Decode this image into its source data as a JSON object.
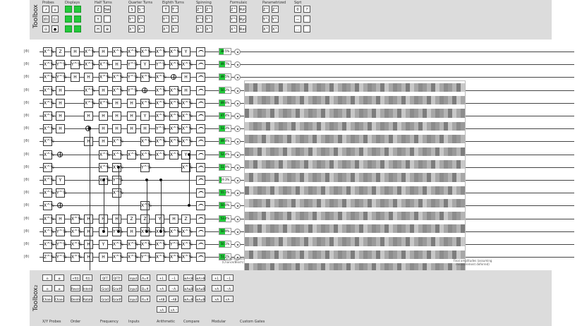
{
  "toolbox_top": {
    "label": "Toolbox",
    "groups": [
      {
        "title": "Probes",
        "gates": [
          "↗",
          "⌂",
          "|0⟩⟨0|",
          "|1⟩⟨1|",
          "⊙",
          "●"
        ]
      },
      {
        "title": "Displays",
        "gates": [
          "",
          "",
          "",
          "",
          "",
          ""
        ],
        "green": true
      },
      {
        "title": "Half Turns",
        "gates": [
          "Z",
          "Swap",
          "Y",
          "",
          "H",
          "⊕"
        ]
      },
      {
        "title": "Quarter Turns",
        "gates": [
          "S",
          "S⁻¹",
          "Y^½",
          "Y^-½",
          "X^½",
          "X^-½"
        ]
      },
      {
        "title": "Eighth Turns",
        "gates": [
          "T",
          "T⁻¹",
          "Y^¼",
          "Y^-¼",
          "X^¼",
          "X^-¼"
        ]
      },
      {
        "title": "Spinning",
        "gates": [
          "Z^t",
          "Z^-t",
          "Y^t",
          "Y^-t",
          "X^t",
          "X^-t"
        ]
      },
      {
        "title": "Formulaic",
        "gates": [
          "Z^f(t)",
          "Rz(f(t))",
          "Y^f(t)",
          "Ry(f(t))",
          "X^f(t)",
          "Rx(f(t))"
        ]
      },
      {
        "title": "Parametrized",
        "gates": [
          "Z^A/2ⁿ",
          "Z^-A/2ⁿ",
          "Y^A/2ⁿ",
          "Y^-A/2ⁿ",
          "X^A/2ⁿ",
          "X^-A/2ⁿ"
        ]
      },
      {
        "title": "Sqrt",
        "gates": [
          "0",
          "?",
          "—",
          "",
          "...",
          ""
        ]
      }
    ]
  },
  "toolbox_bottom": {
    "label": "Toolbox₂",
    "groups": [
      {
        "title": "X/Y Probes",
        "gates": [
          "⊖",
          "⊗",
          "⊖",
          "⊗",
          "Chance",
          "Chance"
        ]
      },
      {
        "title": "Order",
        "gates": [
          "+f(t)",
          "-f(t)",
          "Reverse",
          "Interleave",
          "Deinterleave",
          "Rotate"
        ]
      },
      {
        "title": "Frequency",
        "gates": [
          "QFT",
          "QFT†",
          "Grad",
          "Grad†",
          "Grad",
          "Grad†"
        ]
      },
      {
        "title": "Inputs",
        "gates": [
          "input A",
          "A=# default",
          "input B",
          "B=# default",
          "input R",
          "R=# default"
        ]
      },
      {
        "title": "Arithmetic",
        "gates": [
          "+1",
          "−1",
          "+A",
          "−A",
          "+AB",
          "−AB",
          "×A",
          "×A⁻¹"
        ]
      },
      {
        "title": "Compare",
        "gates": [
          "⊕A<B",
          "⊕A>B",
          "⊕A≤B",
          "⊕A≥B",
          "⊕A=B",
          "⊕A≠B"
        ]
      },
      {
        "title": "Modular",
        "gates": [
          "+1 mod R",
          "−1 mod R",
          "+A mod R",
          "−A mod R",
          "×A mod R",
          "×A⁻¹ mod R"
        ]
      },
      {
        "title": "Custom Gates",
        "gates": []
      }
    ]
  },
  "circuit": {
    "ket_label": "|0⟩",
    "wire_count": 17,
    "probabilities": [
      "38.5%",
      "49.7%",
      "49.5%",
      "50.2%",
      "49.8%",
      "47.4%",
      "51.3%",
      "49.4%",
      "52.4%",
      "51.9%",
      "19.3%",
      "55.1%",
      "50.0%",
      "53.4%",
      "50.9%",
      "50.1%",
      "51.2%"
    ],
    "prob_fill": [
      0.385,
      0.497,
      0.495,
      0.502,
      0.498,
      0.474,
      0.513,
      0.494,
      0.524,
      0.519,
      0.193,
      0.551,
      0.5,
      0.534,
      0.509,
      0.501,
      0.512
    ],
    "columns": [
      [
        "X^½",
        "X^½",
        "X^½",
        "X^½",
        "X^½",
        "X^½",
        "X^½",
        "X^½",
        "X^½",
        "X^½",
        "X^½",
        "X^½",
        "X^½",
        "X^½",
        "X^½",
        "X^½",
        "Z^½"
      ],
      [
        "Z",
        "Y^½",
        "Y^½",
        "H",
        "H",
        "H",
        "H",
        "",
        "⊕",
        "",
        "Y",
        "Y^½",
        "⊕",
        "H",
        "Y^½",
        "Y^½",
        "Y^½"
      ],
      [
        "H",
        "Y^½",
        "H",
        "",
        "",
        "",
        "",
        "",
        "",
        "",
        "",
        "",
        "",
        "X^½",
        "X^½",
        "X^½",
        "X^½"
      ],
      [
        "X^½",
        "X^½",
        "H",
        "X^½",
        "X^½",
        "H",
        "⊕",
        "H",
        "",
        "",
        "",
        "",
        "",
        "H",
        "H",
        "H",
        "H"
      ],
      [
        "H",
        "X^½",
        "X^½",
        "H",
        "X^½",
        "H",
        "H",
        "H",
        "X^½",
        "X^½",
        "X^½",
        "",
        "",
        "H",
        "Y",
        "Y",
        "H"
      ],
      [
        "X^½",
        "H",
        "X^½",
        "X^½",
        "H",
        "H",
        "H",
        "X^½",
        "X^½",
        "X^½",
        "Y^½",
        "X^½",
        "",
        "H",
        "Y^½",
        "X^½",
        "X^½"
      ],
      [
        "X^½",
        "Y^½",
        "Y^½",
        "Y^½",
        "H",
        "H",
        "H",
        "",
        "X^½",
        "",
        "",
        "",
        "",
        "Z",
        "H",
        "X^½",
        "X^½"
      ],
      [
        "X^½",
        "Y",
        "X^½",
        "⊕",
        "X^½",
        "Y",
        "H",
        "X^½",
        "X^½",
        "Y^½",
        "",
        "",
        "X^½",
        "Z",
        "X^½",
        "X^½",
        "Y^½"
      ],
      [
        "X^½",
        "Y^½",
        "X^½",
        "X^½",
        "X^½",
        "X^½",
        "Y^½",
        "X^½",
        "X^½",
        "",
        "",
        "",
        "",
        "Y",
        "X^½",
        "X^½",
        "X^½"
      ],
      [
        "X^½",
        "X^½",
        "⊕",
        "X^½",
        "X^½",
        "X^½",
        "X^½",
        "X^½",
        "X^½",
        "",
        "",
        "",
        "",
        "H",
        "X^½",
        "Y^½",
        "X^½"
      ],
      [
        "Y",
        "X^½",
        "H",
        "H",
        "X^½",
        "X^½",
        "X^½",
        "X^½",
        "Y",
        "X^½",
        "",
        "",
        "",
        "Z",
        "X^½",
        "X^½",
        "X^½"
      ],
      [
        "↗",
        "↗",
        "↗",
        "↗",
        "↗",
        "↗",
        "↗",
        "↗",
        "↗",
        "↗",
        "↗",
        "↗",
        "↗",
        "↗",
        "↗",
        "↗",
        "↗"
      ]
    ]
  },
  "local_state_label": "Local wire states (Chance/Bloch)",
  "amplitudes_label": "Final amplitudes (assuming measurement deferred)"
}
